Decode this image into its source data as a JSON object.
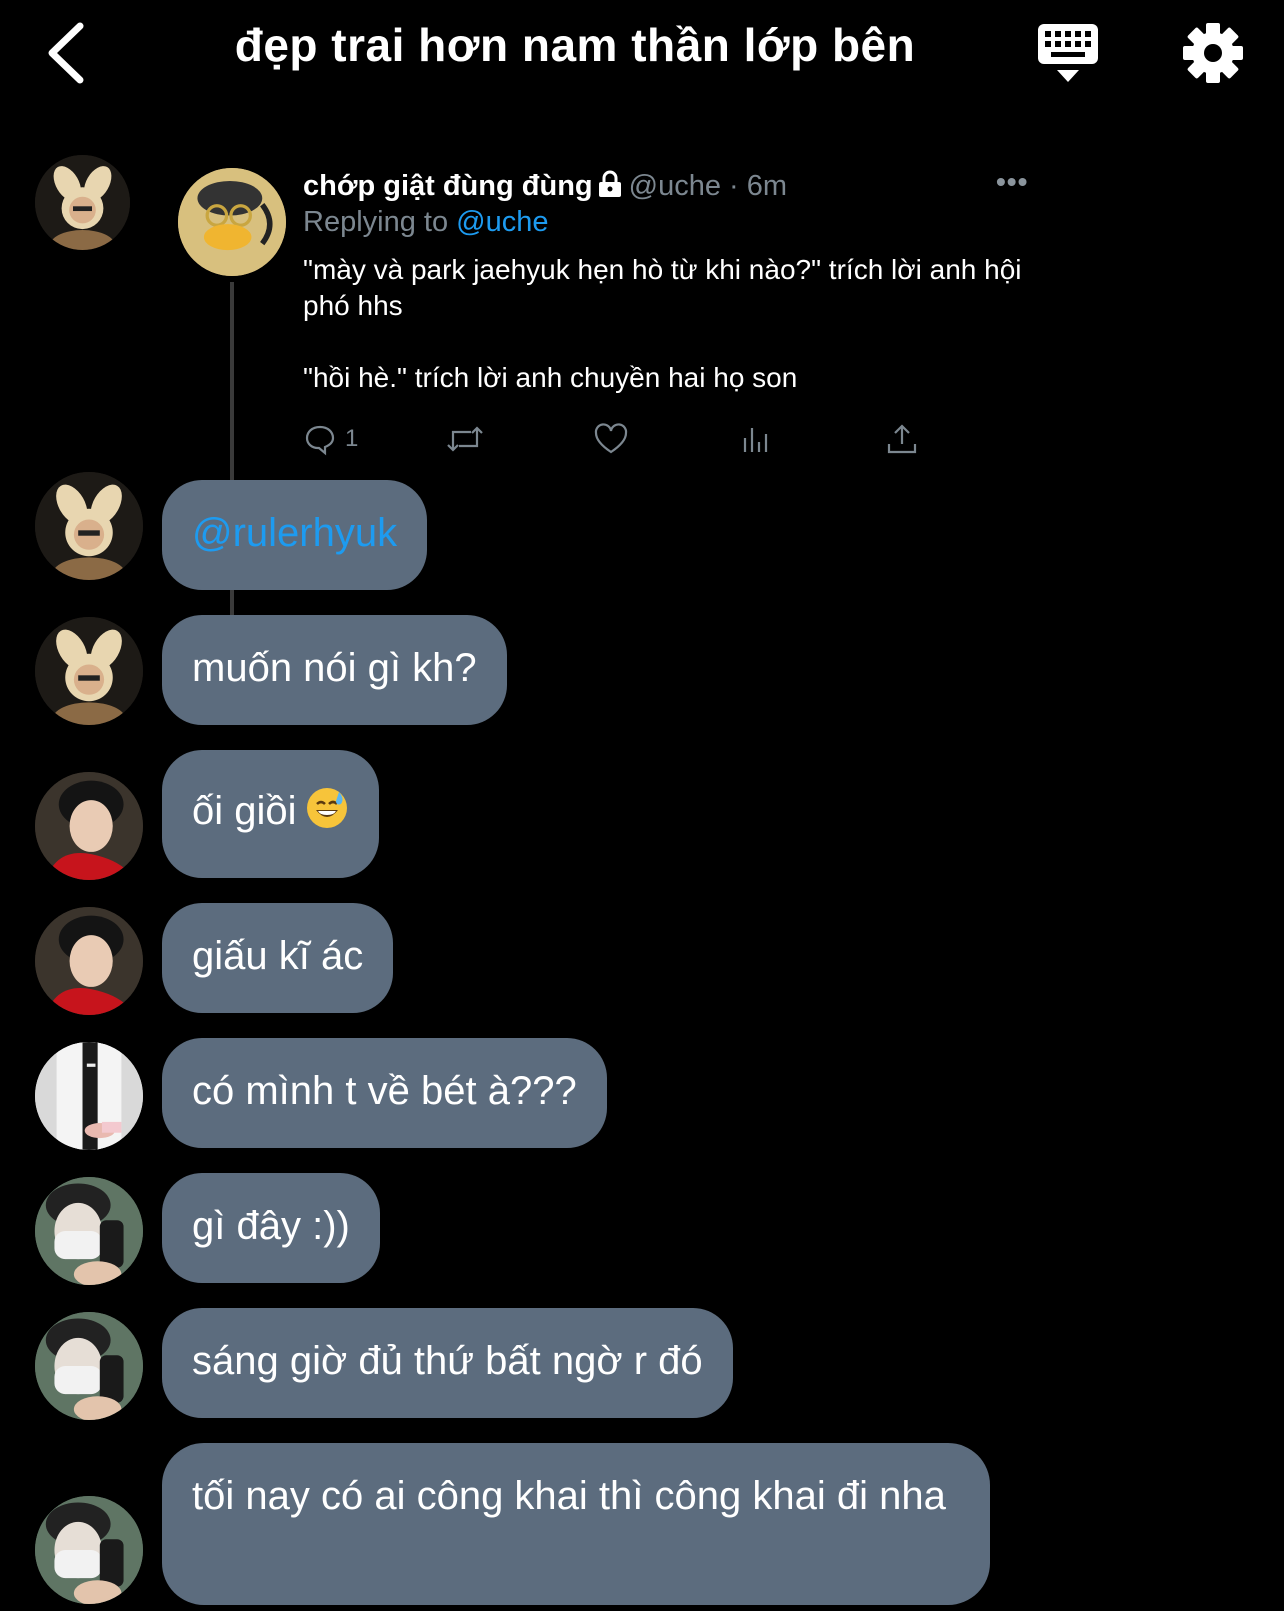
{
  "header": {
    "title": "đẹp trai hơn nam thần lớp bên",
    "back_icon": "chevron-left-icon",
    "keyboard_icon": "keyboard-icon",
    "settings_icon": "gear-icon"
  },
  "tweet": {
    "name": "chớp giật đùng đùng",
    "handle": "@uche",
    "time": "6m",
    "meta_sep": " · ",
    "replying_label": "Replying to",
    "replying_handle": "@uche",
    "line1": "\"mày và park jaehyuk hẹn hò từ khi nào?\" trích lời anh hội phó hhs",
    "line2": "\"hồi hè.\" trích lời anh chuyền hai họ son",
    "reply_count": "1",
    "more": "•••"
  },
  "messages": [
    {
      "text": "@rulerhyuk",
      "avatar": "bunny-ears-avatar"
    },
    {
      "text": "muốn nói gì kh?",
      "avatar": "bunny-ears-avatar"
    },
    {
      "text": "ối giồi",
      "emoji": "sweat-smile-emoji",
      "avatar": "red-scarf-avatar"
    },
    {
      "text": "giấu kĩ ác",
      "avatar": "red-scarf-avatar"
    },
    {
      "text": "có mình t về bét à???",
      "avatar": "white-jacket-avatar"
    },
    {
      "text": "gì đây :))",
      "avatar": "face-mask-avatar"
    },
    {
      "text": "sáng giờ đủ thứ bất ngờ r đó",
      "avatar": "face-mask-avatar"
    },
    {
      "text": "tối nay có ai công khai thì công khai đi nha",
      "avatar": "face-mask-avatar"
    }
  ],
  "colors": {
    "background": "#000000",
    "bubble": "#5c6c7e",
    "link": "#1d9bf0",
    "muted": "#7c8790"
  }
}
